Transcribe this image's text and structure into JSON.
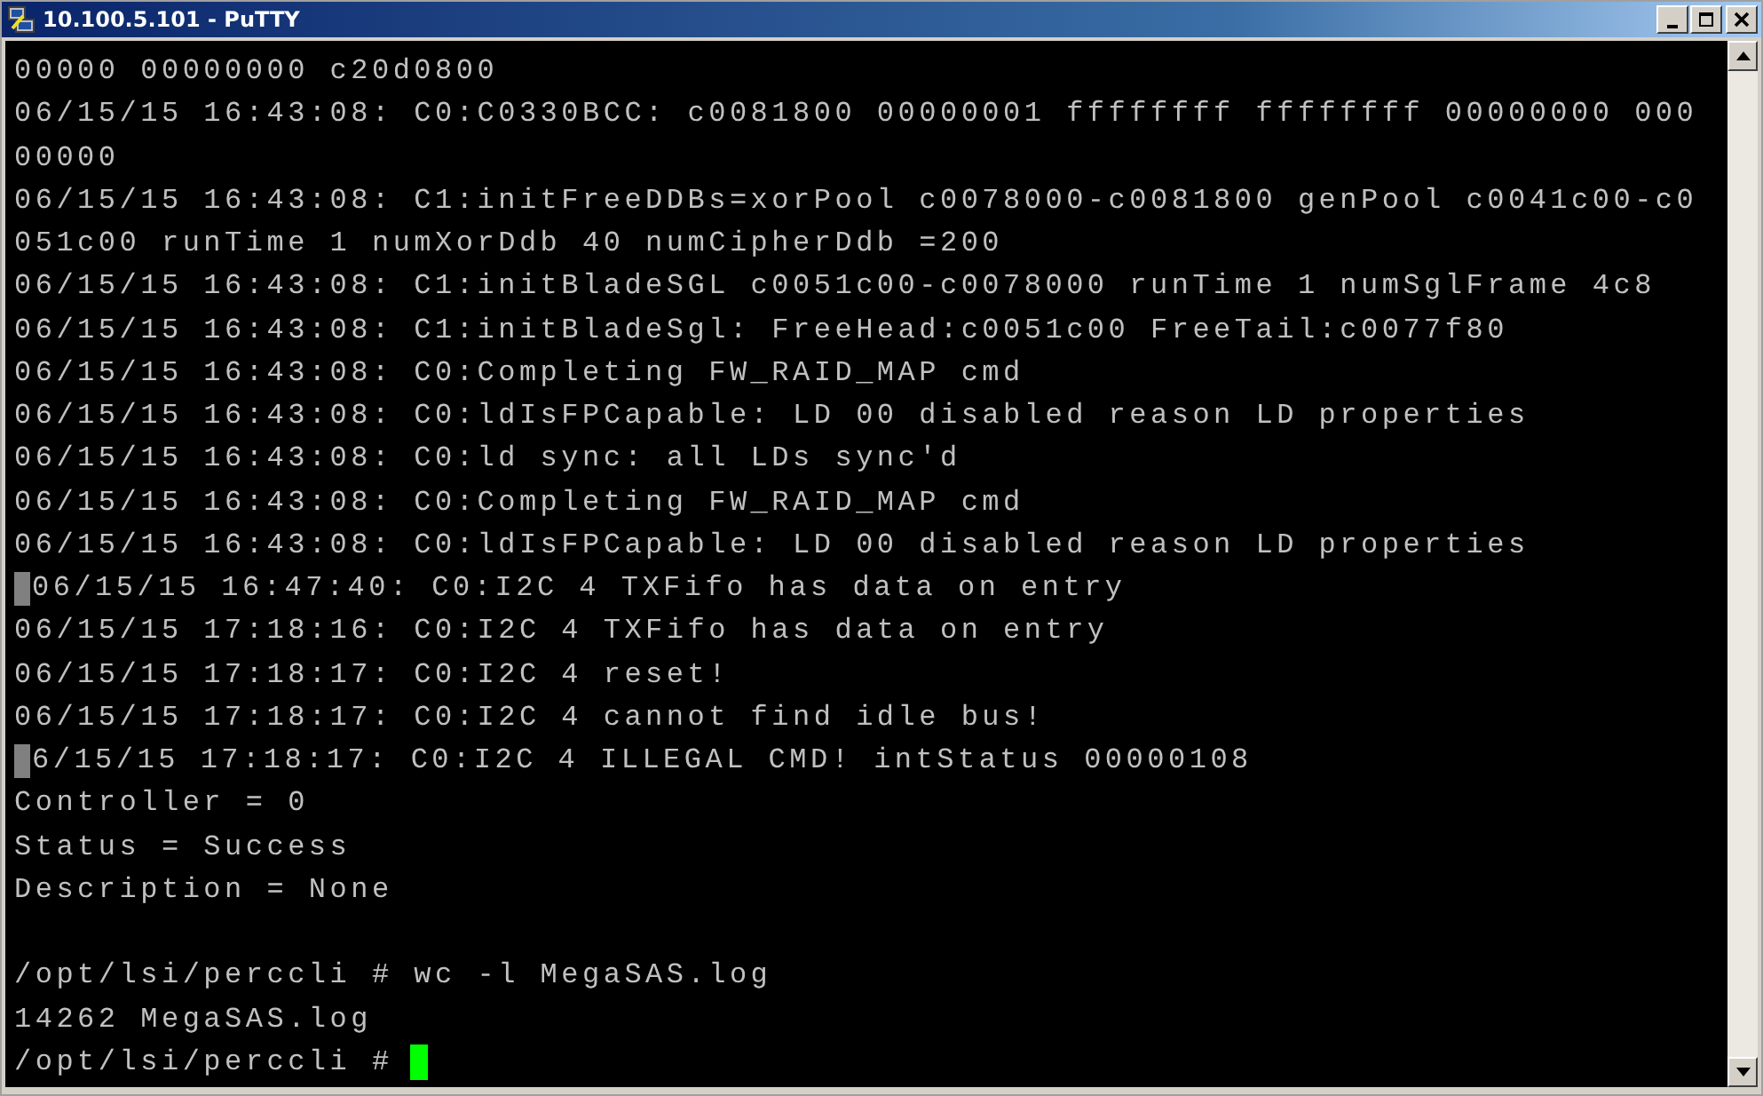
{
  "window": {
    "title": "10.100.5.101 - PuTTY",
    "buttons": [
      {
        "kind": "minimize"
      },
      {
        "kind": "maximize"
      },
      {
        "kind": "close"
      }
    ]
  },
  "terminal": {
    "lines": [
      {
        "kind": "output",
        "text": "00000 00000000 c20d0800"
      },
      {
        "kind": "output",
        "text": "06/15/15 16:43:08: C0:C0330BCC: c0081800 00000001 ffffffff ffffffff 00000000 000"
      },
      {
        "kind": "output",
        "text": "00000"
      },
      {
        "kind": "output",
        "text": "06/15/15 16:43:08: C1:initFreeDDBs=xorPool c0078000-c0081800 genPool c0041c00-c0"
      },
      {
        "kind": "output",
        "text": "051c00 runTime 1 numXorDdb 40 numCipherDdb =200"
      },
      {
        "kind": "output",
        "text": "06/15/15 16:43:08: C1:initBladeSGL c0051c00-c0078000 runTime 1 numSglFrame 4c8"
      },
      {
        "kind": "output",
        "text": "06/15/15 16:43:08: C1:initBladeSgl: FreeHead:c0051c00 FreeTail:c0077f80"
      },
      {
        "kind": "output",
        "text": "06/15/15 16:43:08: C0:Completing FW_RAID_MAP cmd"
      },
      {
        "kind": "output",
        "text": "06/15/15 16:43:08: C0:ldIsFPCapable: LD 00 disabled reason LD properties"
      },
      {
        "kind": "output",
        "text": "06/15/15 16:43:08: C0:ld sync: all LDs sync'd"
      },
      {
        "kind": "output",
        "text": "06/15/15 16:43:08: C0:Completing FW_RAID_MAP cmd"
      },
      {
        "kind": "output",
        "text": "06/15/15 16:43:08: C0:ldIsFPCapable: LD 00 disabled reason LD properties"
      },
      {
        "kind": "marked",
        "text": "06/15/15 16:47:40: C0:I2C 4 TXFifo has data on entry"
      },
      {
        "kind": "output",
        "text": "06/15/15 17:18:16: C0:I2C 4 TXFifo has data on entry"
      },
      {
        "kind": "output",
        "text": "06/15/15 17:18:17: C0:I2C 4 reset!"
      },
      {
        "kind": "output",
        "text": "06/15/15 17:18:17: C0:I2C 4 cannot find idle bus!"
      },
      {
        "kind": "marked",
        "text": "6/15/15 17:18:17: C0:I2C 4 ILLEGAL CMD! intStatus 00000108"
      },
      {
        "kind": "output",
        "text": "Controller = 0"
      },
      {
        "kind": "output",
        "text": "Status = Success"
      },
      {
        "kind": "output",
        "text": "Description = None"
      },
      {
        "kind": "blank"
      },
      {
        "kind": "output",
        "text": "/opt/lsi/perccli # wc -l MegaSAS.log"
      },
      {
        "kind": "output",
        "text": "14262 MegaSAS.log"
      },
      {
        "kind": "prompt",
        "text": "/opt/lsi/perccli #"
      }
    ]
  }
}
